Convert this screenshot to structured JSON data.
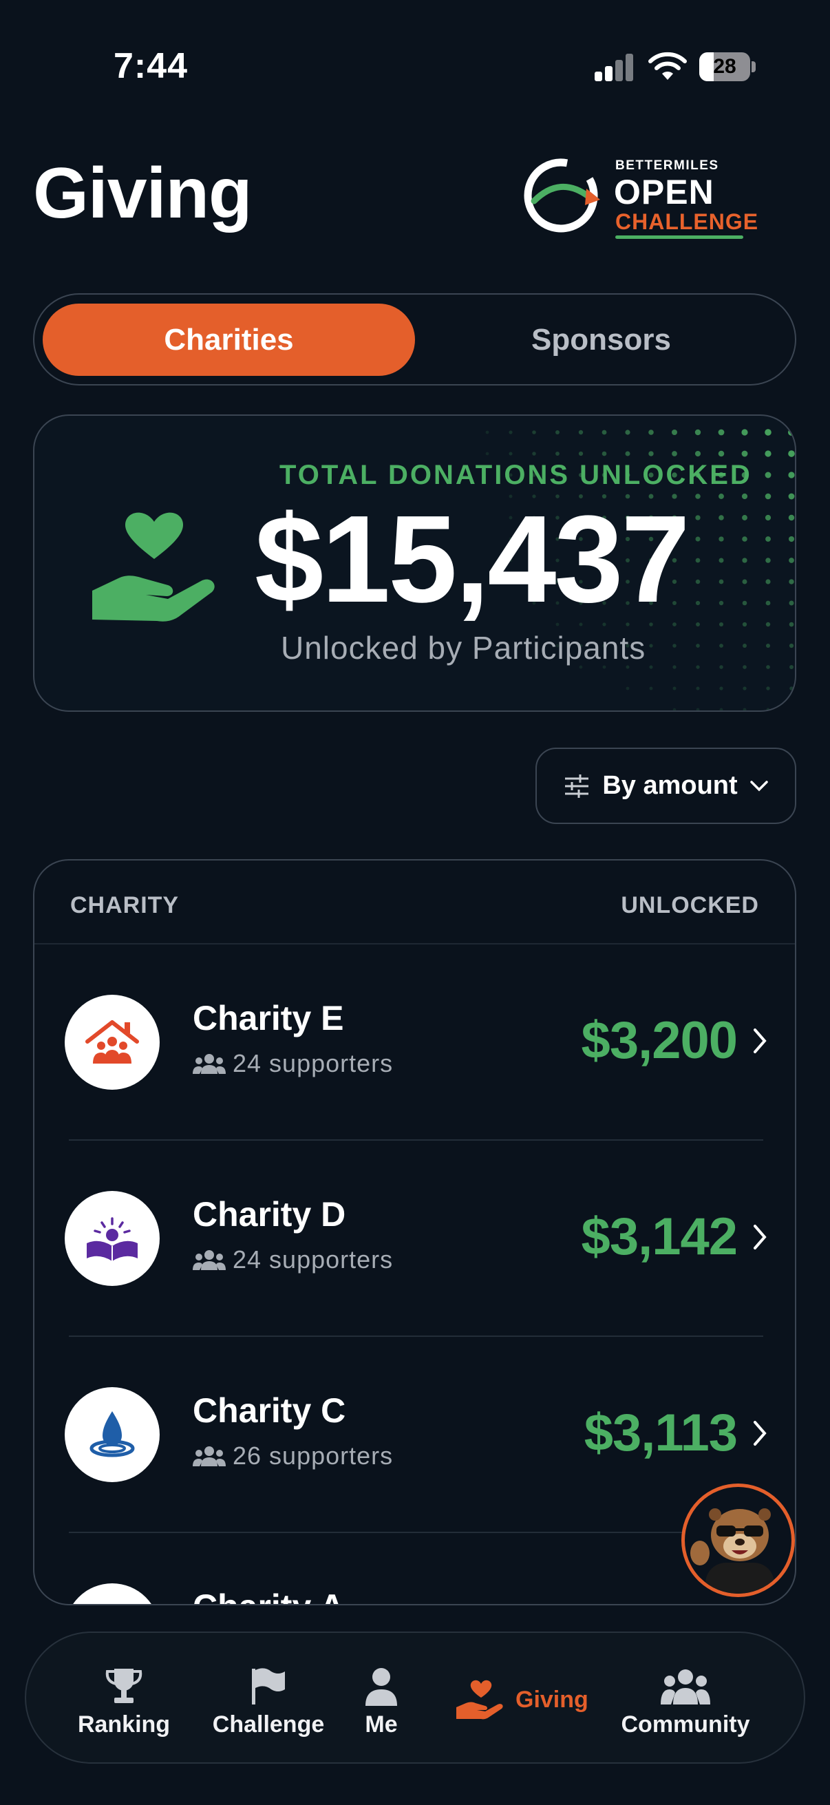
{
  "status_bar": {
    "time": "7:44",
    "battery": "28",
    "battery_level": 0.28
  },
  "header": {
    "title": "Giving",
    "logo": {
      "brand": "BETTERMILES",
      "word1": "OPEN",
      "word2": "CHALLENGE"
    }
  },
  "tabs": [
    {
      "label": "Charities",
      "active": true
    },
    {
      "label": "Sponsors",
      "active": false
    }
  ],
  "total": {
    "label": "TOTAL DONATIONS UNLOCKED",
    "amount": "$15,437",
    "subtitle": "Unlocked by Participants"
  },
  "sort": {
    "label": "By amount"
  },
  "table": {
    "col_charity": "CHARITY",
    "col_unlocked": "UNLOCKED",
    "rows": [
      {
        "name": "Charity E",
        "supporters": "24 supporters",
        "amount": "$3,200",
        "icon": "house-family-icon"
      },
      {
        "name": "Charity D",
        "supporters": "24 supporters",
        "amount": "$3,142",
        "icon": "open-book-sun-icon"
      },
      {
        "name": "Charity C",
        "supporters": "26 supporters",
        "amount": "$3,113",
        "icon": "water-drop-icon"
      },
      {
        "name": "Charity A",
        "supporters": "",
        "amount": "",
        "icon": "charity-icon"
      }
    ]
  },
  "nav": {
    "ranking": "Ranking",
    "challenge": "Challenge",
    "me": "Me",
    "giving": "Giving",
    "community": "Community"
  },
  "colors": {
    "accent": "#e45f2b",
    "green": "#4caf63",
    "background": "#0a121c"
  }
}
